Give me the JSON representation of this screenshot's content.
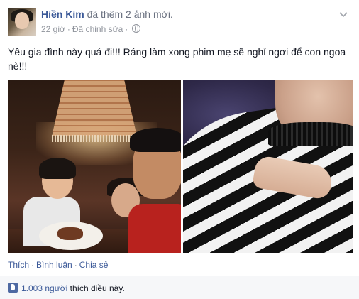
{
  "post": {
    "author": "Hiền Kim",
    "action": "đã thêm 2 ảnh mới.",
    "time": "22 giờ",
    "separator": "·",
    "edited": "Đã chỉnh sửa",
    "message_line1": "Yêu gia đình này quá đi!!! Ráng làm xong phim mẹ sẽ nghỉ ngơi để con ngoa",
    "message_line2": "nè!!!"
  },
  "actions": {
    "like": "Thích",
    "comment": "Bình luận",
    "share": "Chia sẻ",
    "separator": "·"
  },
  "likes": {
    "count": "1.003 người",
    "suffix": "thích điều này."
  },
  "icons": {
    "privacy": "globe-icon",
    "menu": "chevron-down-icon",
    "like": "thumbs-up-icon"
  },
  "colors": {
    "link": "#3b5998",
    "meta": "#90949c",
    "footer_bg": "#f6f7f9"
  }
}
